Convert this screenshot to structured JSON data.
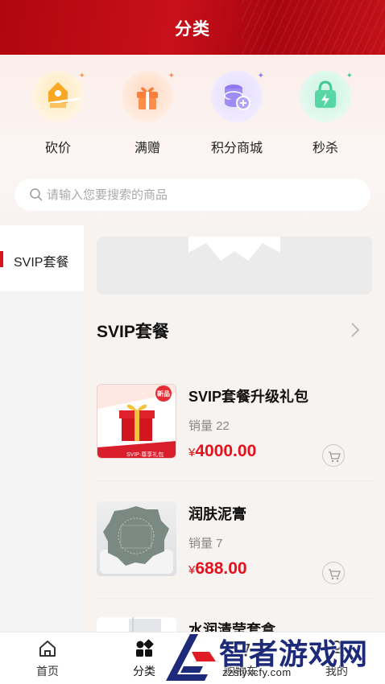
{
  "header": {
    "title": "分类"
  },
  "quick_entries": [
    {
      "label": "砍价",
      "icon": "bargain-icon",
      "color": "#f8b23e"
    },
    {
      "label": "满赠",
      "icon": "gift-box-icon",
      "color": "#fb8f4a"
    },
    {
      "label": "积分商城",
      "icon": "points-coins-icon",
      "color": "#9f8cf3"
    },
    {
      "label": "秒杀",
      "icon": "flash-sale-bag-icon",
      "color": "#58d7a6"
    }
  ],
  "search": {
    "placeholder": "请输入您要搜索的商品"
  },
  "sidebar": {
    "items": [
      {
        "label": "SVIP套餐",
        "active": true
      }
    ]
  },
  "section": {
    "title": "SVIP套餐"
  },
  "products": [
    {
      "name": "SVIP套餐升级礼包",
      "sales": "销量 22",
      "currency": "¥",
      "price": "4000.00",
      "badge": "新品",
      "thumb_caption": "SVIP·尊享礼包"
    },
    {
      "name": "润肤泥膏",
      "sales": "销量 7",
      "currency": "¥",
      "price": "688.00"
    },
    {
      "name": "水润清莹套盒"
    }
  ],
  "tabbar": {
    "items": [
      {
        "label": "首页",
        "icon": "home-icon"
      },
      {
        "label": "分类",
        "icon": "category-icon",
        "active": true
      },
      {
        "label": "购物车",
        "icon": "cart-icon"
      },
      {
        "label": "我的",
        "icon": "user-icon"
      }
    ]
  },
  "watermark": {
    "text": "智者游戏网",
    "url": "zzslyxcfy.com"
  },
  "colors": {
    "brand_red": "#c8101a",
    "price_red": "#e60f1b"
  }
}
